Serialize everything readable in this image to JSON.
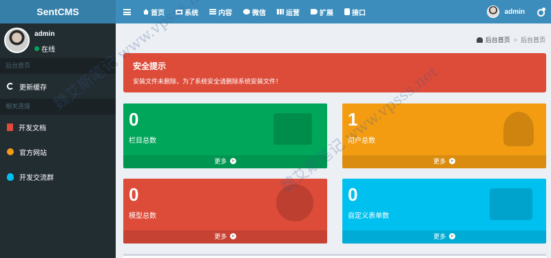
{
  "header": {
    "logo": "SentCMS",
    "nav": [
      {
        "label": "首页",
        "icon": "home-icon"
      },
      {
        "label": "系统",
        "icon": "laptop-icon"
      },
      {
        "label": "内容",
        "icon": "list-icon"
      },
      {
        "label": "微信",
        "icon": "wechat-icon"
      },
      {
        "label": "运营",
        "icon": "grid-icon"
      },
      {
        "label": "扩展",
        "icon": "tag-icon"
      },
      {
        "label": "接口",
        "icon": "database-icon"
      }
    ],
    "user_name": "admin"
  },
  "sidebar": {
    "user": {
      "name": "admin",
      "status": "在线"
    },
    "sections": [
      {
        "header": "后台首页",
        "items": [
          {
            "label": "更新缓存",
            "icon": "refresh-icon"
          }
        ]
      },
      {
        "header": "相关连接",
        "items": [
          {
            "label": "开发文档",
            "icon": "file-icon"
          },
          {
            "label": "官方网站",
            "icon": "globe-icon"
          },
          {
            "label": "开发交流群",
            "icon": "qq-icon"
          }
        ]
      }
    ]
  },
  "breadcrumb": {
    "home": "后台首页",
    "current": "后台首页"
  },
  "alert": {
    "title": "安全提示",
    "text": "安装文件未删除，为了系统安全请删除系统安装文件！"
  },
  "boxes": [
    {
      "value": "0",
      "label": "栏目总数",
      "more": "更多",
      "color": "#00a65a"
    },
    {
      "value": "1",
      "label": "用户总数",
      "more": "更多",
      "color": "#f39c12"
    },
    {
      "value": "0",
      "label": "模型总数",
      "more": "更多",
      "color": "#dd4b39"
    },
    {
      "value": "0",
      "label": "自定义表单数",
      "more": "更多",
      "color": "#00c0ef"
    }
  ],
  "watermark": "魏艾斯笔记 www.vpsss.net",
  "colors": {
    "header": "#3c8dbc",
    "sidebar": "#222d32"
  }
}
